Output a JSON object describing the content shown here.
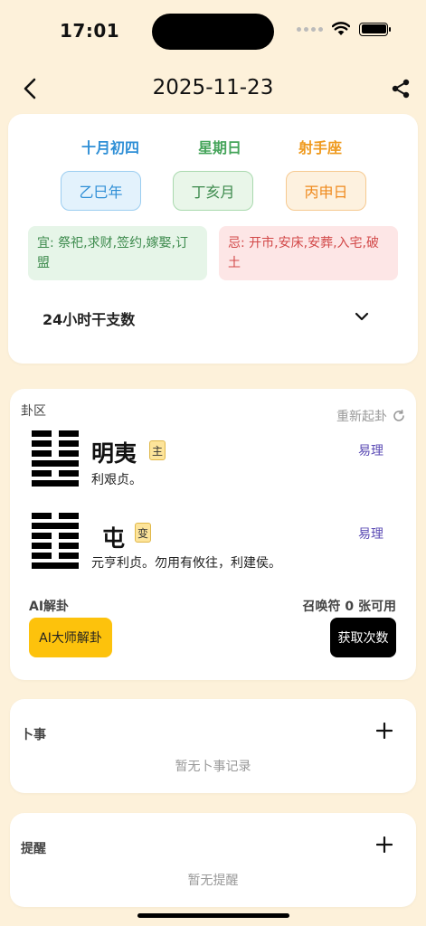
{
  "status": {
    "time": "17:01"
  },
  "nav": {
    "title": "2025-11-23"
  },
  "date_card": {
    "lunar_date": "十月初四",
    "weekday": "星期日",
    "zodiac": "射手座",
    "year_ganzhi": "乙巳年",
    "month_ganzhi": "丁亥月",
    "day_ganzhi": "丙申日",
    "yi": "宜: 祭祀,求财,签约,嫁娶,订盟",
    "ji": "忌: 开市,安床,安葬,入宅,破土",
    "hours_label": "24小时干支数"
  },
  "gua_card": {
    "section_label": "卦区",
    "redo_label": "重新起卦",
    "main": {
      "name": "明夷",
      "tag": "主",
      "text": "利艰贞。",
      "link": "易理"
    },
    "changed": {
      "name": "屯",
      "tag": "变",
      "text": "元亨利贞。勿用有攸往，利建侯。",
      "link": "易理"
    },
    "ai_label": "AI解卦",
    "summon_text": "召唤符 0 张可用",
    "ai_button": "AI大师解卦",
    "get_button": "获取次数"
  },
  "divination": {
    "title": "卜事",
    "empty": "暂无卜事记录"
  },
  "reminder": {
    "title": "提醒",
    "empty": "暂无提醒"
  },
  "colors": {
    "background": "#fdf1da",
    "lunar": "#2f8fd6",
    "weekday": "#45a45a",
    "zodiac": "#ef9a1e",
    "yi_text": "#3c8a4c",
    "ji_text": "#d24848",
    "accent_button": "#fdc20c",
    "link": "#5b4bb4"
  }
}
